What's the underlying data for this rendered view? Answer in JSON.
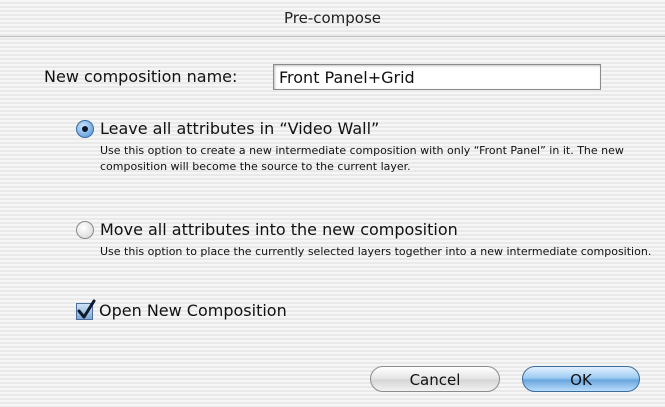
{
  "dialog": {
    "title": "Pre-compose"
  },
  "name_field": {
    "label": "New composition name:",
    "value": "Front Panel+Grid"
  },
  "options": [
    {
      "label": "Leave all attributes in “Video Wall”",
      "description": "Use this option to create a new intermediate composition with only “Front Panel” in it.  The new composition will become the source to the current layer.",
      "selected": true
    },
    {
      "label": "Move all attributes into the new composition",
      "description": "Use this option to place the currently selected layers together into a new intermediate composition.",
      "selected": false
    }
  ],
  "open_new": {
    "label": "Open New Composition",
    "checked": true
  },
  "buttons": {
    "cancel": "Cancel",
    "ok": "OK"
  },
  "colors": {
    "accent": "#6aa6df",
    "radio_selected": "#3d7cc3"
  },
  "icons": {
    "radio_selected": "radio-selected-icon",
    "radio_unselected": "radio-unselected-icon",
    "checkbox_checked": "checkmark-icon"
  }
}
